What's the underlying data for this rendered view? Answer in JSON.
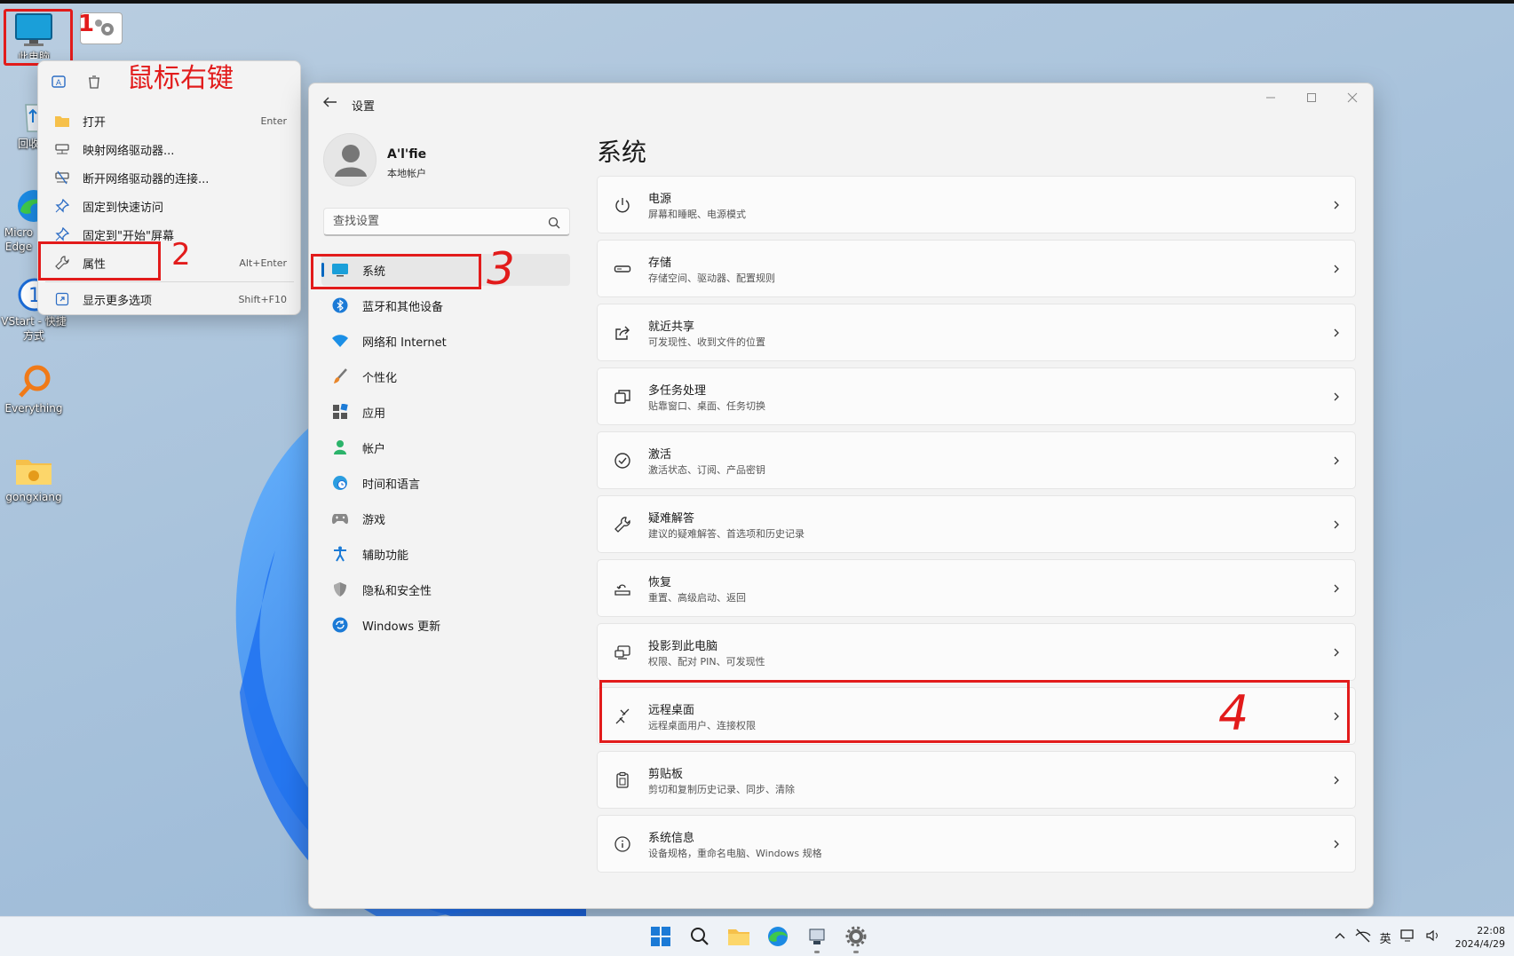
{
  "desktop": {
    "icons": [
      {
        "name": "computer",
        "label": "此电脑"
      },
      {
        "name": "recycle",
        "label": "回收站"
      },
      {
        "name": "edge",
        "label": "Micro Edge"
      },
      {
        "name": "vstart",
        "label": "VStart - 快捷方式"
      },
      {
        "name": "everything",
        "label": "Everything"
      },
      {
        "name": "gongxiang",
        "label": "gongxiang"
      }
    ]
  },
  "context_menu": {
    "items": [
      {
        "label": "打开",
        "shortcut": "Enter"
      },
      {
        "label": "映射网络驱动器...",
        "shortcut": ""
      },
      {
        "label": "断开网络驱动器的连接...",
        "shortcut": ""
      },
      {
        "label": "固定到快速访问",
        "shortcut": ""
      },
      {
        "label": "固定到\"开始\"屏幕",
        "shortcut": ""
      },
      {
        "label": "属性",
        "shortcut": "Alt+Enter"
      },
      {
        "label": "显示更多选项",
        "shortcut": "Shift+F10"
      }
    ]
  },
  "annotations": {
    "step1": "1",
    "right_click": "鼠标右键",
    "step2": "2",
    "step3": "3",
    "step4": "4"
  },
  "settings": {
    "window_title": "设置",
    "user_name": "A'l'fie",
    "user_type": "本地帐户",
    "search_placeholder": "查找设置",
    "page_title": "系统",
    "nav": [
      {
        "label": "系统",
        "icon": "monitor-icon"
      },
      {
        "label": "蓝牙和其他设备",
        "icon": "bluetooth-icon"
      },
      {
        "label": "网络和 Internet",
        "icon": "wifi-icon"
      },
      {
        "label": "个性化",
        "icon": "brush-icon"
      },
      {
        "label": "应用",
        "icon": "apps-icon"
      },
      {
        "label": "帐户",
        "icon": "person-icon"
      },
      {
        "label": "时间和语言",
        "icon": "globe-clock-icon"
      },
      {
        "label": "游戏",
        "icon": "gamepad-icon"
      },
      {
        "label": "辅助功能",
        "icon": "accessibility-icon"
      },
      {
        "label": "隐私和安全性",
        "icon": "shield-icon"
      },
      {
        "label": "Windows 更新",
        "icon": "update-icon"
      }
    ],
    "cards": [
      {
        "title": "电源",
        "subtitle": "屏幕和睡眠、电源模式",
        "icon": "power-icon"
      },
      {
        "title": "存储",
        "subtitle": "存储空间、驱动器、配置规则",
        "icon": "storage-icon"
      },
      {
        "title": "就近共享",
        "subtitle": "可发现性、收到文件的位置",
        "icon": "share-icon"
      },
      {
        "title": "多任务处理",
        "subtitle": "贴靠窗口、桌面、任务切换",
        "icon": "multitask-icon"
      },
      {
        "title": "激活",
        "subtitle": "激活状态、订阅、产品密钥",
        "icon": "check-circle-icon"
      },
      {
        "title": "疑难解答",
        "subtitle": "建议的疑难解答、首选项和历史记录",
        "icon": "wrench-icon"
      },
      {
        "title": "恢复",
        "subtitle": "重置、高级启动、返回",
        "icon": "recovery-icon"
      },
      {
        "title": "投影到此电脑",
        "subtitle": "权限、配对 PIN、可发现性",
        "icon": "project-icon"
      },
      {
        "title": "远程桌面",
        "subtitle": "远程桌面用户、连接权限",
        "icon": "remote-desktop-icon"
      },
      {
        "title": "剪贴板",
        "subtitle": "剪切和复制历史记录、同步、清除",
        "icon": "clipboard-icon"
      },
      {
        "title": "系统信息",
        "subtitle": "设备规格，重命名电脑、Windows 规格",
        "icon": "info-icon"
      }
    ]
  },
  "taskbar": {
    "ime": "英",
    "time": "22:08",
    "date": "2024/4/29"
  },
  "colors": {
    "accent": "#0067c0",
    "annotation": "#e21b1b"
  }
}
